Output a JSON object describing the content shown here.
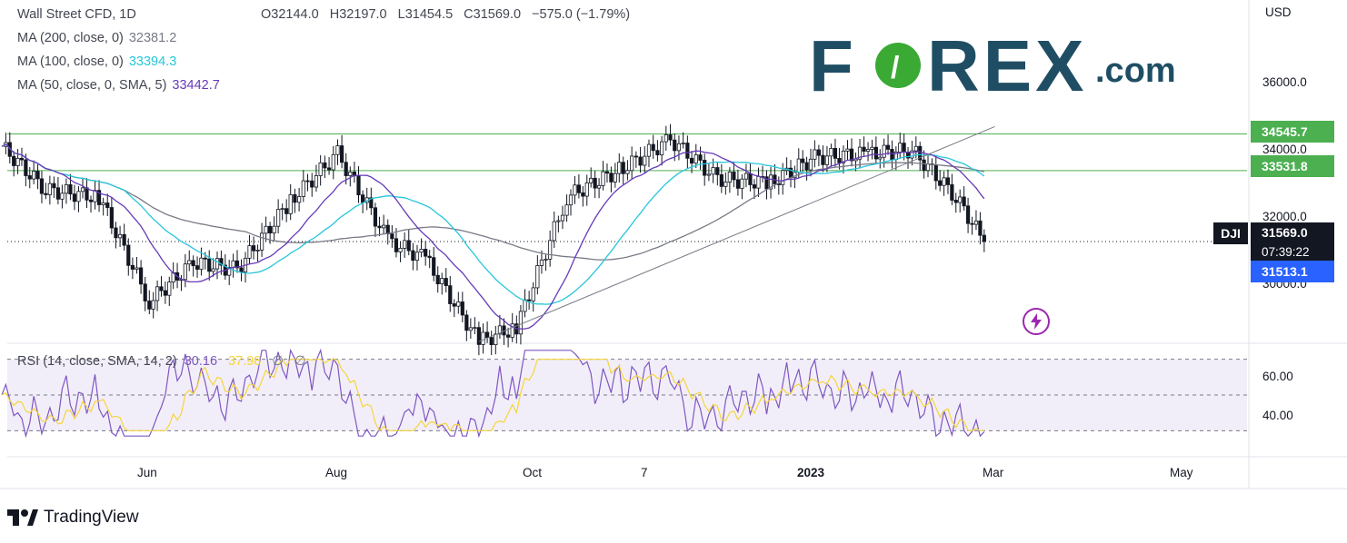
{
  "header": {
    "symbol": "Wall Street CFD, 1D",
    "open": "O32144.0",
    "high": "H32197.0",
    "low": "L31454.5",
    "close": "C31569.0",
    "change": "−575.0 (−1.79%)"
  },
  "ma_legend": [
    {
      "label": "MA (200, close, 0)",
      "value": "32381.2",
      "color": "#787b86"
    },
    {
      "label": "MA (100, close, 0)",
      "value": "33394.3",
      "color": "#26c6da"
    },
    {
      "label": "MA (50, close, 0, SMA, 5)",
      "value": "33442.7",
      "color": "#673ab7"
    }
  ],
  "rsi_legend": {
    "label": "RSI (14, close, SMA, 14, 2)",
    "rsi": "30.16",
    "sma": "37.98",
    "extra1": "∅",
    "extra2": "∅"
  },
  "currency": "USD",
  "price_axis": [
    "36000.0",
    "34000.0",
    "32000.0",
    "30000.0"
  ],
  "rsi_axis": [
    "60.00",
    "40.00"
  ],
  "time_axis": [
    "Jun",
    "Aug",
    "Oct",
    "7",
    "2023",
    "Mar",
    "May"
  ],
  "price_tags": [
    {
      "value": "34545.7",
      "color": "#4caf50"
    },
    {
      "value": "33531.8",
      "color": "#4caf50"
    },
    {
      "value": "31569.0",
      "color": "#131722",
      "countdown": "07:39:22",
      "symbol": "DJI"
    },
    {
      "value": "31513.1",
      "color": "#2962ff"
    }
  ],
  "brand": {
    "forex": "F◉REX",
    "forex_suffix": ".com",
    "tradingview": "TradingView"
  },
  "icons": {
    "flash": "flash-icon",
    "tradingview": "tradingview-logo-icon"
  },
  "chart_data": {
    "type": "candlestick",
    "title": "Wall Street CFD, 1D",
    "ylim": [
      28000,
      37500
    ],
    "horizontal_levels": [
      34545.7,
      33531.8
    ],
    "last_close": 31569.0,
    "x_range": [
      "2022-05-01",
      "2023-05-31"
    ],
    "price_series": [
      {
        "date": "2022-05-01",
        "close": 34200
      },
      {
        "date": "2022-05-15",
        "close": 33000
      },
      {
        "date": "2022-06-01",
        "close": 32800
      },
      {
        "date": "2022-06-17",
        "close": 29900
      },
      {
        "date": "2022-07-01",
        "close": 31000
      },
      {
        "date": "2022-07-15",
        "close": 30800
      },
      {
        "date": "2022-08-01",
        "close": 32700
      },
      {
        "date": "2022-08-16",
        "close": 34000
      },
      {
        "date": "2022-09-01",
        "close": 31600
      },
      {
        "date": "2022-09-13",
        "close": 31100
      },
      {
        "date": "2022-09-30",
        "close": 28800
      },
      {
        "date": "2022-10-12",
        "close": 29200
      },
      {
        "date": "2022-10-28",
        "close": 32800
      },
      {
        "date": "2022-11-15",
        "close": 33600
      },
      {
        "date": "2022-11-30",
        "close": 34400
      },
      {
        "date": "2022-12-15",
        "close": 33300
      },
      {
        "date": "2023-01-01",
        "close": 33200
      },
      {
        "date": "2023-01-15",
        "close": 33900
      },
      {
        "date": "2023-02-01",
        "close": 34000
      },
      {
        "date": "2023-02-15",
        "close": 34100
      },
      {
        "date": "2023-03-01",
        "close": 32800
      },
      {
        "date": "2023-03-10",
        "close": 31569
      }
    ],
    "rsi": {
      "ylim": [
        20,
        80
      ],
      "levels": [
        70,
        50,
        30
      ],
      "last_rsi": 30.16,
      "last_sma": 37.98
    }
  }
}
